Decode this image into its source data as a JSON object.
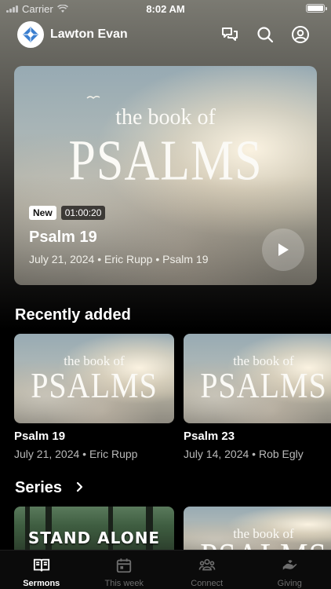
{
  "status_bar": {
    "carrier": "Carrier",
    "time": "8:02 AM"
  },
  "header": {
    "church_name": "Lawton Evan",
    "icons": [
      "chat-icon",
      "search-icon",
      "profile-icon"
    ]
  },
  "featured": {
    "art_line1": "the book of",
    "art_line2": "PSALMS",
    "badge_new": "New",
    "duration": "01:00:20",
    "title": "Psalm 19",
    "date": "July 21, 2024",
    "speaker": "Eric Rupp",
    "scripture": "Psalm 19"
  },
  "recently_added": {
    "title": "Recently added",
    "items": [
      {
        "art_line1": "the book of",
        "art_line2": "PSALMS",
        "title": "Psalm 19",
        "meta": "July 21, 2024 • Eric Rupp"
      },
      {
        "art_line1": "the book of",
        "art_line2": "PSALMS",
        "title": "Psalm 23",
        "meta": "July 14, 2024 • Rob Egly"
      }
    ]
  },
  "series": {
    "title": "Series",
    "items": [
      {
        "art_text": "STAND ALONE"
      },
      {
        "art_line1": "the book of",
        "art_line2": "PSALMS"
      }
    ]
  },
  "tabs": [
    {
      "label": "Sermons",
      "icon": "book-icon",
      "active": true
    },
    {
      "label": "This week",
      "icon": "calendar-icon",
      "active": false
    },
    {
      "label": "Connect",
      "icon": "people-icon",
      "active": false
    },
    {
      "label": "Giving",
      "icon": "giving-hand-icon",
      "active": false
    }
  ],
  "colors": {
    "background": "#000000",
    "tab_inactive": "#6d6d6d",
    "meta_text": "#b9b9b9"
  }
}
